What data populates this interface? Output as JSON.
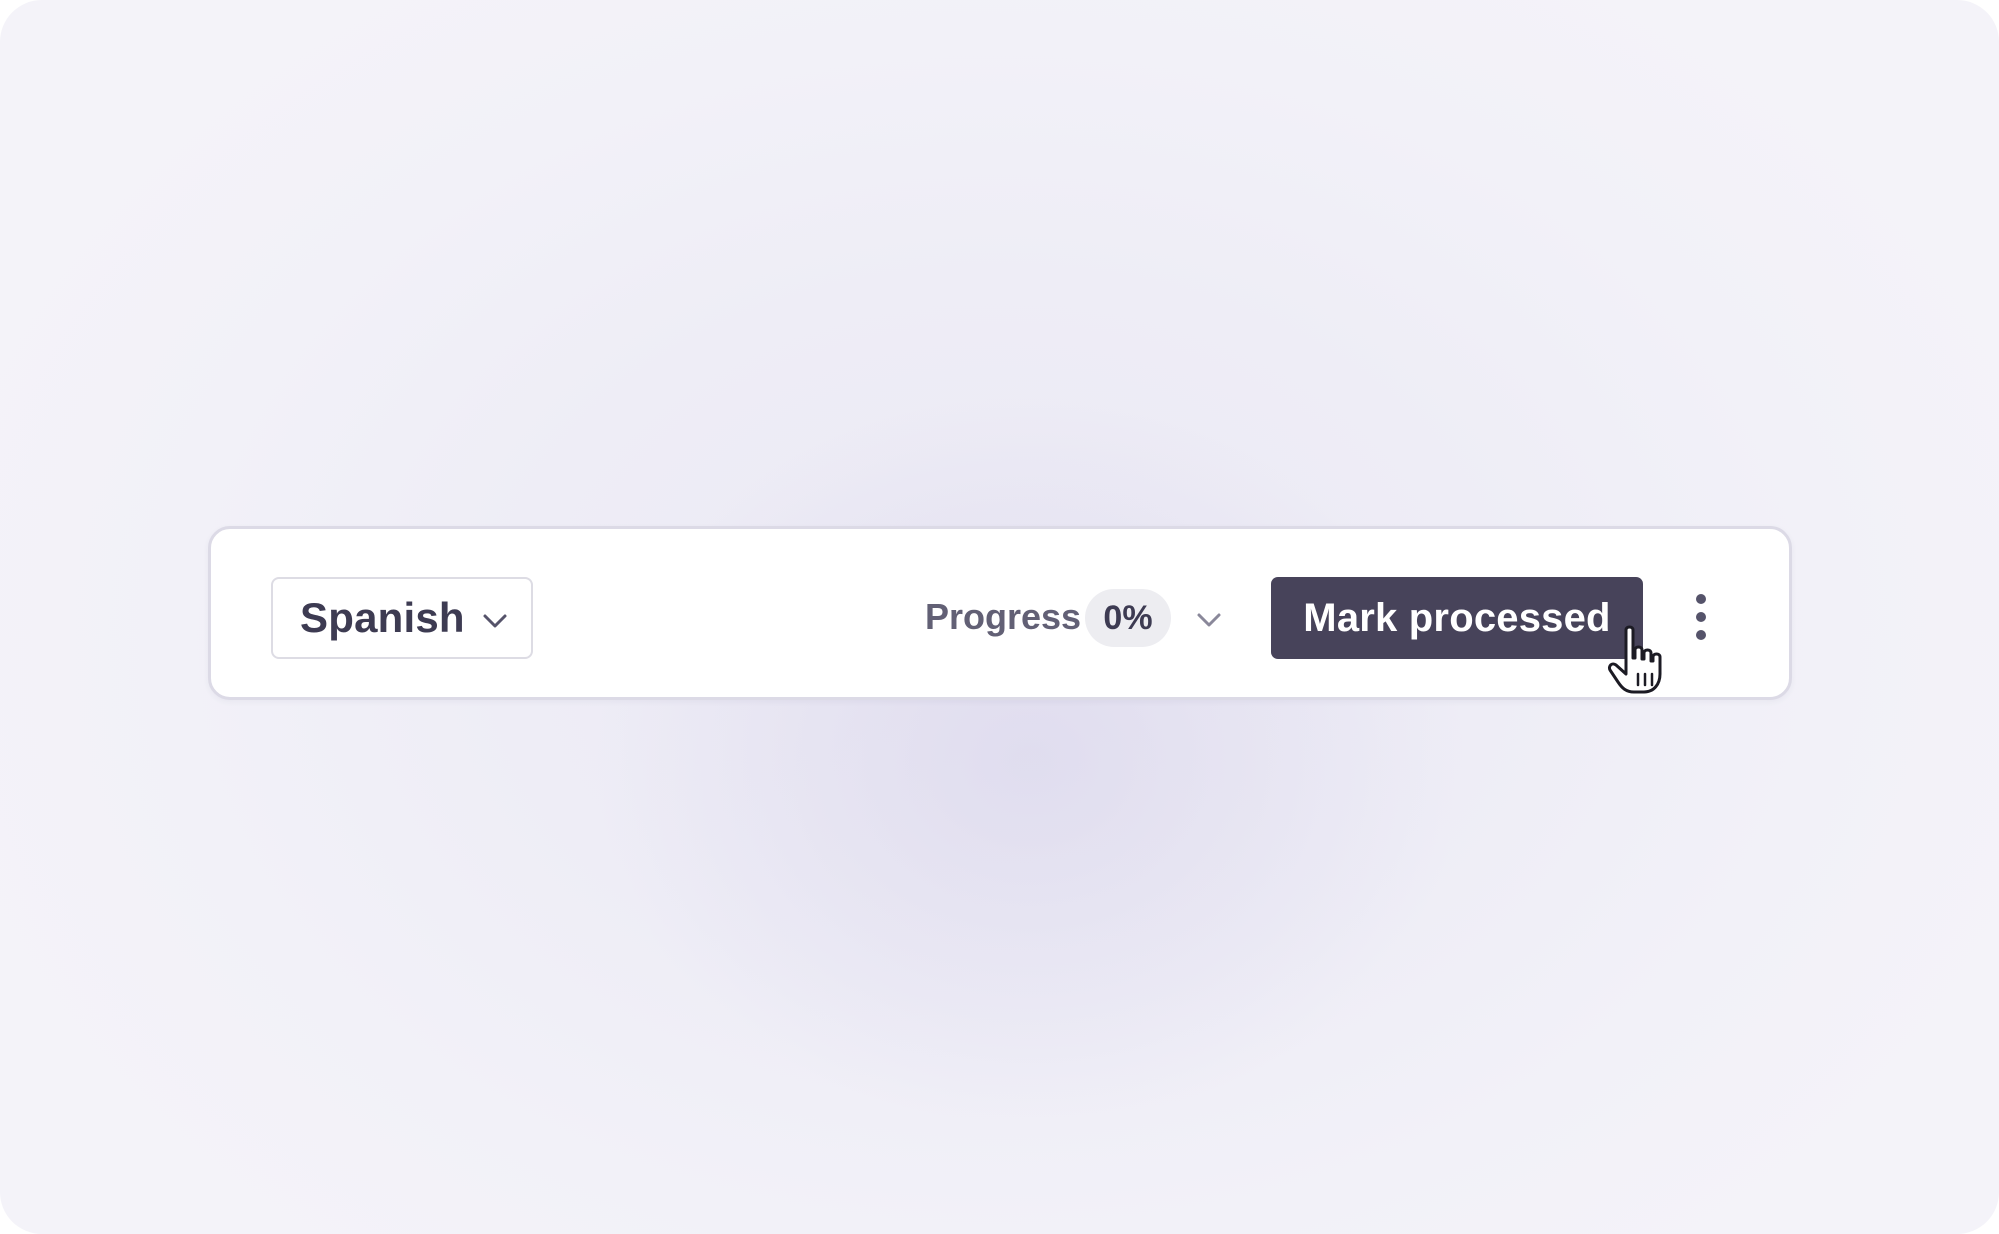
{
  "toolbar": {
    "language_select": {
      "value": "Spanish",
      "icon": "chevron-down-icon"
    },
    "progress": {
      "label": "Progress",
      "value": "0%",
      "toggle_icon": "chevron-down-icon"
    },
    "primary_button": {
      "label": "Mark processed",
      "color": "#47435a"
    },
    "more_button": {
      "icon": "more-vertical-icon"
    }
  },
  "cursor": {
    "icon": "hand-pointer-cursor-icon"
  },
  "colors": {
    "background": "#efeef6",
    "panel": "#ffffff",
    "panel_border": "#dcdae6",
    "text_primary": "#3d3b52",
    "text_muted": "#626075",
    "pill_bg": "#ededf1"
  }
}
